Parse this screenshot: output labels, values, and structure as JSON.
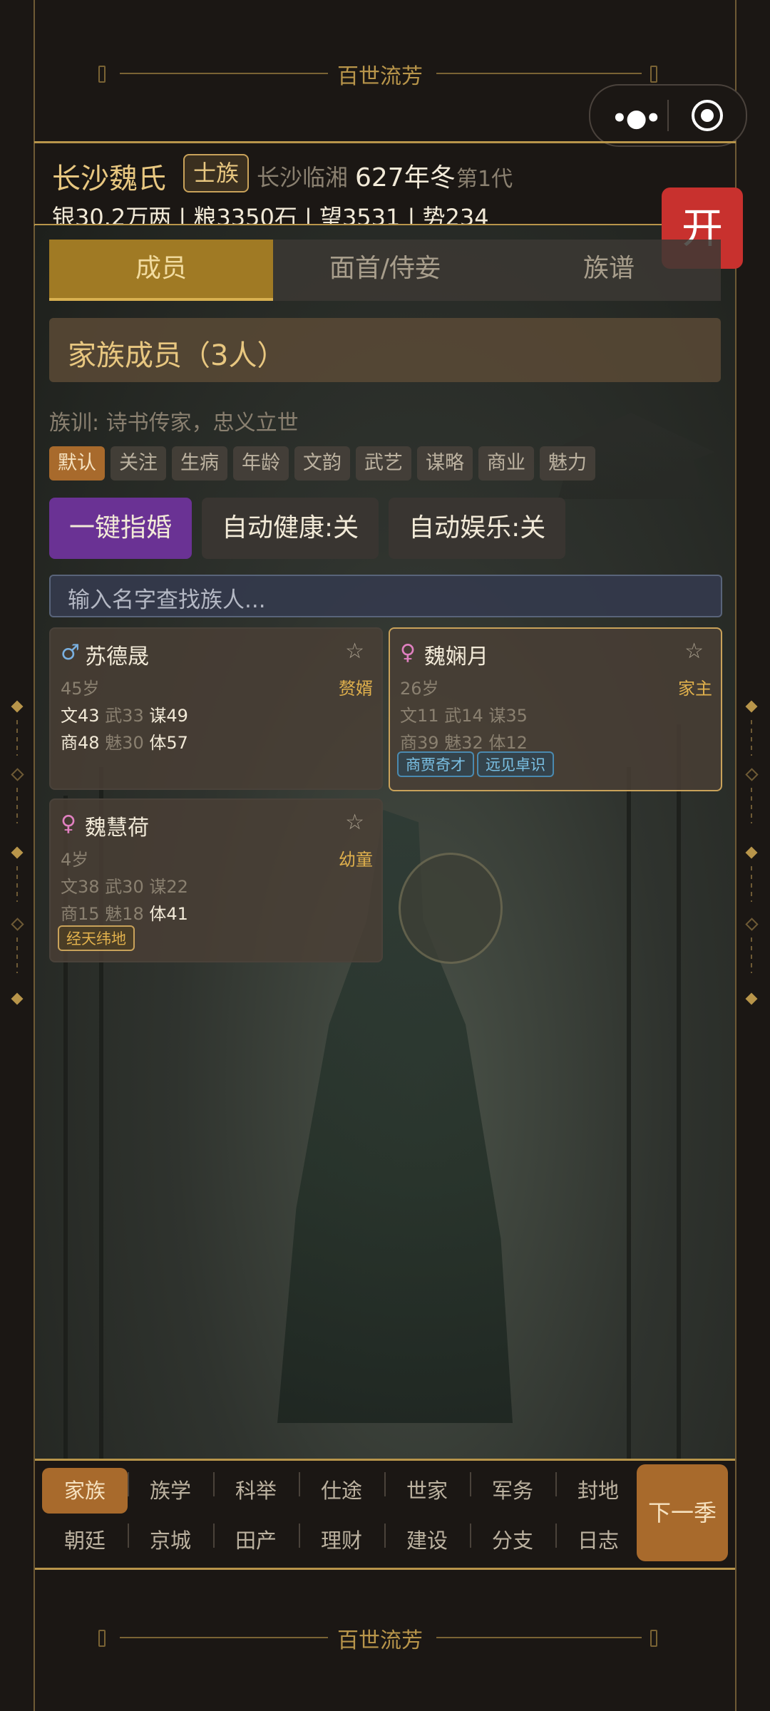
{
  "banner": {
    "title": "百世流芳"
  },
  "header": {
    "family_name": "长沙魏氏",
    "rank": "士族",
    "place": "长沙临湘",
    "year": "627年冬",
    "generation": "第1代",
    "resources": "银30.2万两 | 粮3350石 | 望3531 | 势234"
  },
  "open_button": "开",
  "tabs": [
    {
      "label": "成员",
      "active": true
    },
    {
      "label": "面首/侍妾",
      "active": false
    },
    {
      "label": "族谱",
      "active": false
    }
  ],
  "panel": {
    "title": "家族成员（3人）",
    "motto": "族训: 诗书传家，忠义立世"
  },
  "filters": [
    "默认",
    "关注",
    "生病",
    "年龄",
    "文韵",
    "武艺",
    "谋略",
    "商业",
    "魅力"
  ],
  "actions": {
    "matchmake": "一键指婚",
    "auto_health": "自动健康:关",
    "auto_fun": "自动娱乐:关"
  },
  "search": {
    "placeholder": "输入名字查找族人..."
  },
  "members": [
    {
      "gender_icon": "♂",
      "name": "苏德晟",
      "star": "☆",
      "age": "45岁",
      "role": "赘婿",
      "stats1": {
        "wen": "文43",
        "wu": "武33",
        "mou": "谋49"
      },
      "stats2": {
        "shang": "商48",
        "mei": "魅30",
        "ti": "体57"
      },
      "traits": []
    },
    {
      "gender_icon": "♀",
      "name": "魏娴月",
      "star": "☆",
      "age": "26岁",
      "role": "家主",
      "stats1": {
        "wen": "文11",
        "wu": "武14",
        "mou": "谋35"
      },
      "stats2": {
        "shang": "商39",
        "mei": "魅32",
        "ti": "体12"
      },
      "traits": [
        "商贾奇才",
        "远见卓识"
      ]
    },
    {
      "gender_icon": "♀",
      "name": "魏慧荷",
      "star": "☆",
      "age": "4岁",
      "role": "幼童",
      "stats1": {
        "wen": "文38",
        "wu": "武30",
        "mou": "谋22"
      },
      "stats2": {
        "shang": "商15",
        "mei": "魅18",
        "ti": "体41"
      },
      "traits": [
        "经天纬地"
      ]
    }
  ],
  "nav": {
    "row1": [
      "家族",
      "族学",
      "科举",
      "仕途",
      "世家",
      "军务",
      "封地"
    ],
    "row2": [
      "朝廷",
      "京城",
      "田产",
      "理财",
      "建设",
      "分支",
      "日志"
    ],
    "next": "下一季"
  },
  "colors": {
    "accent_gold": "#b8954a",
    "active_orange": "#a86a2c",
    "purple": "#6a3294",
    "open_red": "#c8312e"
  }
}
